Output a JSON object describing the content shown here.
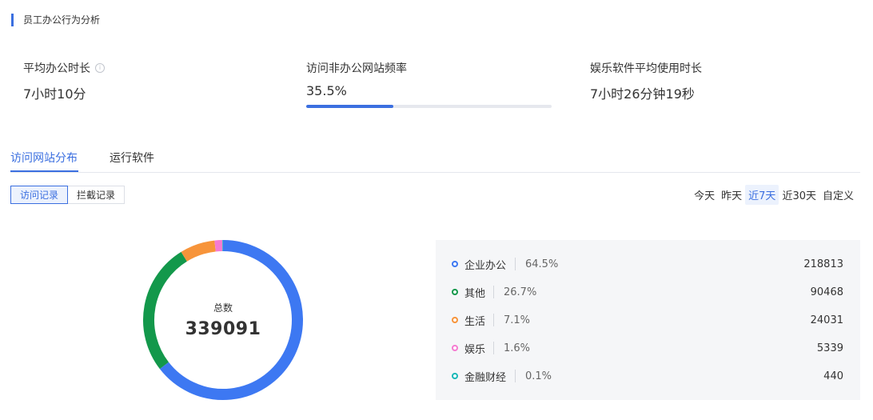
{
  "section": {
    "title": "员工办公行为分析"
  },
  "metrics": [
    {
      "label": "平均办公时长",
      "value": "7小时10分",
      "has_info_icon": true
    },
    {
      "label": "访问非办公网站频率",
      "value": "35.5%",
      "progress": 0.355
    },
    {
      "label": "娱乐软件平均使用时长",
      "value": "7小时26分钟19秒"
    }
  ],
  "tabs": [
    {
      "label": "访问网站分布",
      "active": true
    },
    {
      "label": "运行软件",
      "active": false
    }
  ],
  "segments": [
    {
      "label": "访问记录",
      "active": true
    },
    {
      "label": "拦截记录",
      "active": false
    }
  ],
  "date_ranges": [
    {
      "label": "今天",
      "active": false
    },
    {
      "label": "昨天",
      "active": false
    },
    {
      "label": "近7天",
      "active": true
    },
    {
      "label": "近30天",
      "active": false
    },
    {
      "label": "自定义",
      "active": false
    }
  ],
  "chart_data": {
    "type": "pie",
    "center_label": "总数",
    "total": "339091",
    "categories": [
      "企业办公",
      "其他",
      "生活",
      "娱乐",
      "金融财经"
    ],
    "values": [
      218813,
      90468,
      24031,
      5339,
      440
    ],
    "percents": [
      "64.5%",
      "26.7%",
      "7.1%",
      "1.6%",
      "0.1%"
    ],
    "colors": [
      "#3d78f2",
      "#13984b",
      "#f7943a",
      "#f57bd1",
      "#1ab8b8"
    ]
  }
}
